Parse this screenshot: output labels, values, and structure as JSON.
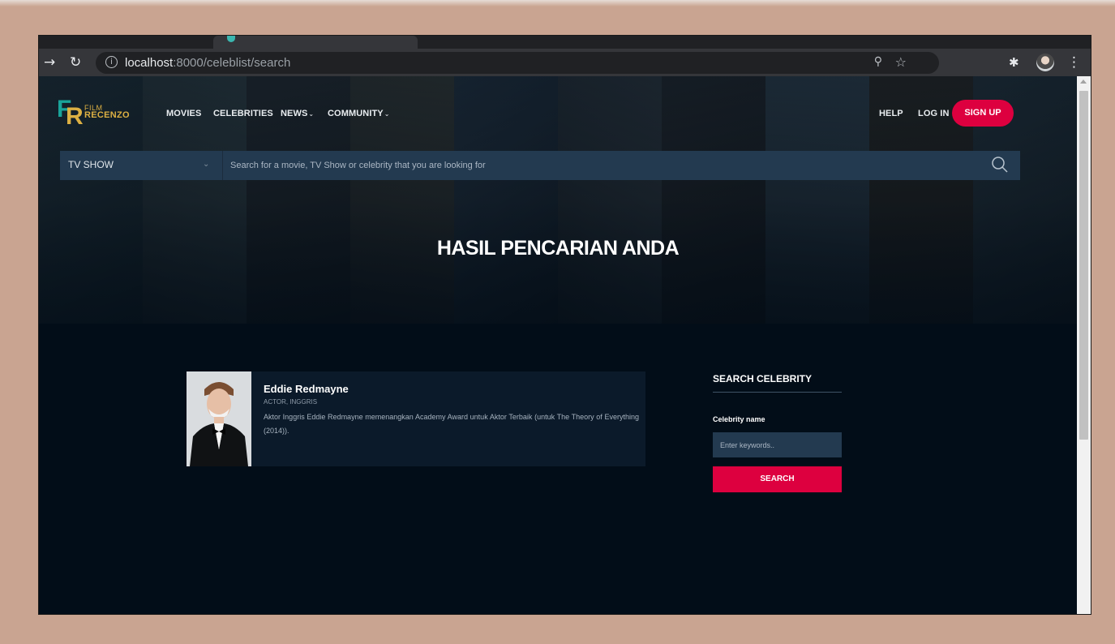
{
  "browser": {
    "url_host": "localhost",
    "url_path": ":8000/celeblist/search"
  },
  "header": {
    "logo": {
      "line1": "FILM",
      "line2": "RECENZO"
    },
    "nav": [
      {
        "label": "MOVIES",
        "dropdown": false
      },
      {
        "label": "CELEBRITIES",
        "dropdown": false
      },
      {
        "label": "NEWS",
        "dropdown": true
      },
      {
        "label": "COMMUNITY",
        "dropdown": true
      }
    ],
    "help": "HELP",
    "login": "LOG IN",
    "signup": "SIGN UP"
  },
  "search": {
    "category": "TV SHOW",
    "placeholder": "Search for a movie, TV Show or celebrity that you are looking for"
  },
  "hero_title": "HASIL PENCARIAN ANDA",
  "results": [
    {
      "name": "Eddie Redmayne",
      "role": "ACTOR, INGGRIS",
      "description": "Aktor Inggris Eddie Redmayne memenangkan Academy Award untuk Aktor Terbaik (untuk The Theory of Everything (2014))."
    }
  ],
  "sidebar": {
    "title": "SEARCH CELEBRITY",
    "field_label": "Celebrity name",
    "placeholder": "Enter keywords..",
    "button": "SEARCH"
  },
  "colors": {
    "accent": "#dd003f",
    "panel": "#233a50",
    "background": "#020d18",
    "logo_gold": "#dcb043",
    "logo_teal": "#1aa39a"
  }
}
